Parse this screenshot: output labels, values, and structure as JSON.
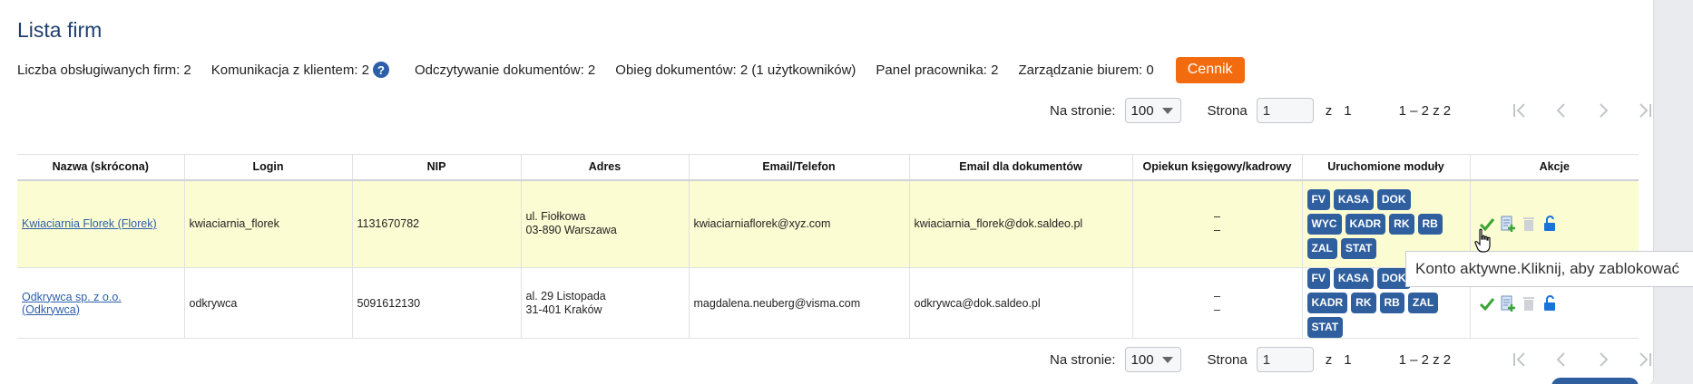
{
  "page": {
    "title": "Lista firm"
  },
  "stats": {
    "firms": "Liczba obsługiwanych firm: 2",
    "communication": "Komunikacja z klientem: 2",
    "help_glyph": "?",
    "reading": "Odczytywanie dokumentów: 2",
    "circulation": "Obieg dokumentów: 2 (1 użytkowników)",
    "employee_panel": "Panel pracownika: 2",
    "office_management": "Zarządzanie biurem: 0",
    "pricing_button": "Cennik"
  },
  "pager": {
    "per_page_label": "Na stronie:",
    "per_page_value": "100",
    "page_label": "Strona",
    "page_value": "1",
    "of_label": "z",
    "total_pages": "1",
    "range": "1 – 2 z 2"
  },
  "table": {
    "headers": [
      "Nazwa (skrócona)",
      "Login",
      "NIP",
      "Adres",
      "Email/Telefon",
      "Email dla dokumentów",
      "Opiekun księgowy/kadrowy",
      "Uruchomione moduły",
      "Akcje"
    ],
    "rows": [
      {
        "name": "Kwiaciarnia Florek (Florek)",
        "login": "kwiaciarnia_florek",
        "nip": "1131670782",
        "address_line1": "ul. Fiołkowa",
        "address_line2": "03-890 Warszawa",
        "email": "kwiaciarniaflorek@xyz.com",
        "doc_email": "kwiaciarnia_florek@dok.saldeo.pl",
        "caretaker_line1": "–",
        "caretaker_line2": "–",
        "modules": [
          "FV",
          "KASA",
          "DOK",
          "WYC",
          "KADR",
          "RK",
          "RB",
          "ZAL",
          "STAT"
        ]
      },
      {
        "name": "Odkrywca sp. z o.o. (Odkrywca)",
        "login": "odkrywca",
        "nip": "5091612130",
        "address_line1": "al. 29 Listopada",
        "address_line2": "31-401 Kraków",
        "email": "magdalena.neuberg@visma.com",
        "doc_email": "odkrywca@dok.saldeo.pl",
        "caretaker_line1": "–",
        "caretaker_line2": "–",
        "modules": [
          "FV",
          "KASA",
          "DOK",
          "KADR",
          "RK",
          "RB",
          "ZAL",
          "STAT"
        ]
      }
    ]
  },
  "tooltip": {
    "text": "Konto aktywne.Kliknij, aby zablokować"
  },
  "colors": {
    "accent_orange": "#f26b0f",
    "badge_blue": "#2f5f9e",
    "title_blue": "#1e3f6e",
    "row_highlight": "#fbfcd2",
    "check_green": "#3aa534",
    "lock_blue": "#1a73d9"
  },
  "icons": {
    "active_status": "check-icon",
    "add_document": "add-document-icon",
    "delete": "trash-icon",
    "lock": "unlock-icon"
  }
}
